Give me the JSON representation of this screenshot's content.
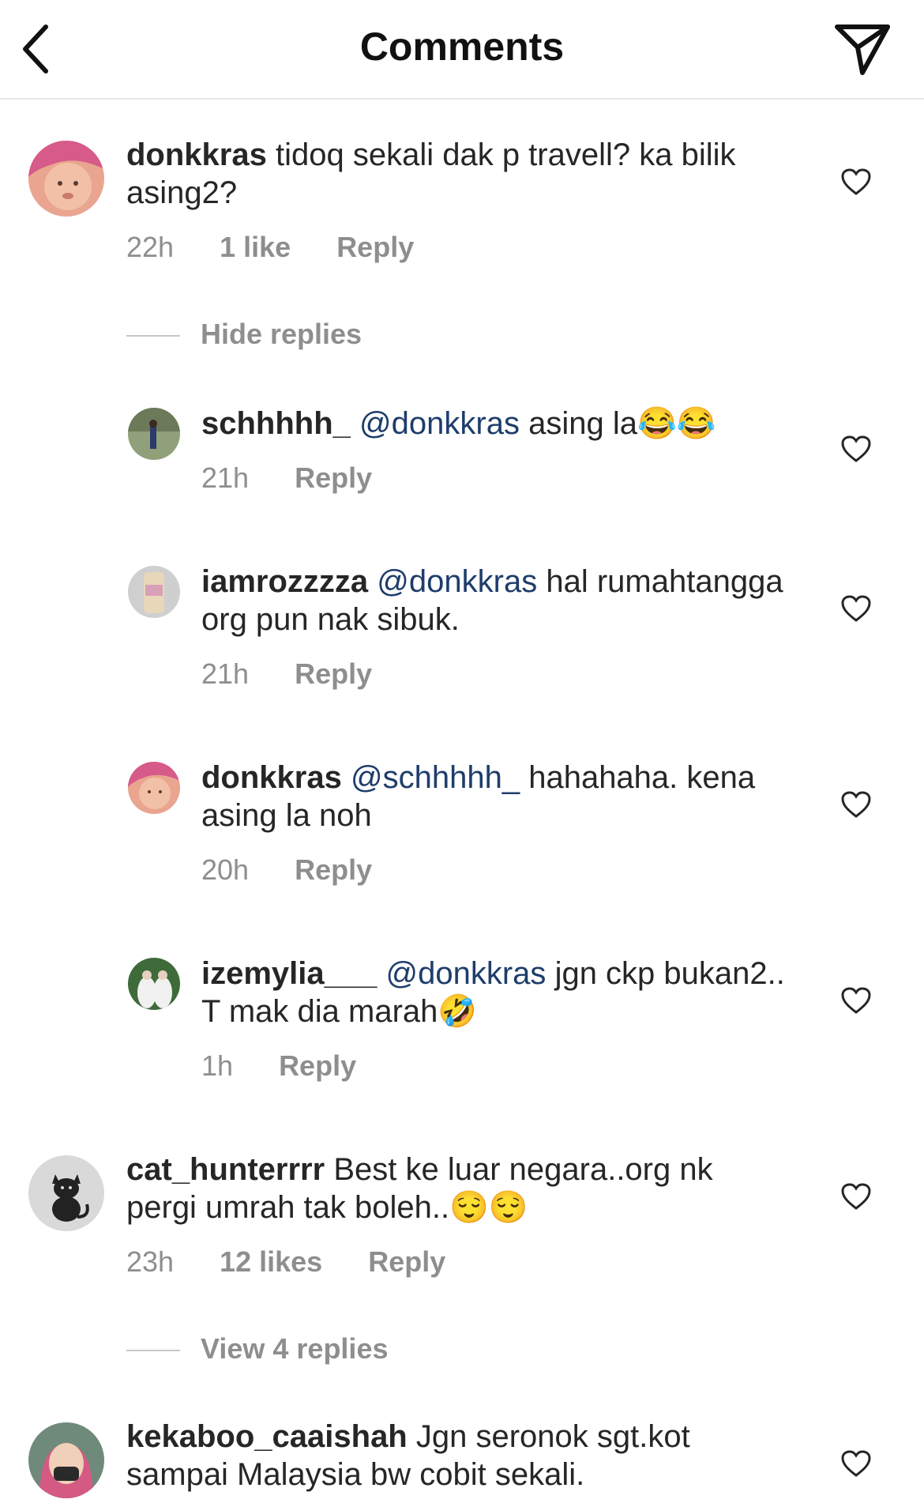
{
  "header": {
    "title": "Comments"
  },
  "comments": [
    {
      "username": "donkkras",
      "text": "tidoq sekali dak p travell? ka bilik asing2?",
      "time": "22h",
      "likes": "1 like",
      "reply": "Reply",
      "toggle": "Hide replies",
      "replies": [
        {
          "username": "schhhhh_",
          "mention": "@donkkras",
          "text": "asing la",
          "emoji": "😂😂",
          "time": "21h",
          "reply": "Reply"
        },
        {
          "username": "iamrozzzza",
          "mention": "@donkkras",
          "text": "hal rumahtangga org pun nak sibuk.",
          "emoji": "",
          "time": "21h",
          "reply": "Reply"
        },
        {
          "username": "donkkras",
          "mention": "@schhhhh_",
          "text": "hahahaha. kena asing la noh",
          "emoji": "",
          "time": "20h",
          "reply": "Reply"
        },
        {
          "username": "izemylia___",
          "mention": "@donkkras",
          "text": "jgn ckp bukan2.. T mak dia marah",
          "emoji": "🤣",
          "time": "1h",
          "reply": "Reply"
        }
      ]
    },
    {
      "username": "cat_hunterrrr",
      "text": "Best ke luar negara..org nk pergi umrah tak boleh..",
      "emoji": "😌😌",
      "time": "23h",
      "likes": "12 likes",
      "reply": "Reply",
      "toggle": "View 4 replies"
    },
    {
      "username": "kekaboo_caaishah",
      "text": "Jgn seronok sgt.kot sampai Malaysia bw cobit sekali."
    }
  ]
}
